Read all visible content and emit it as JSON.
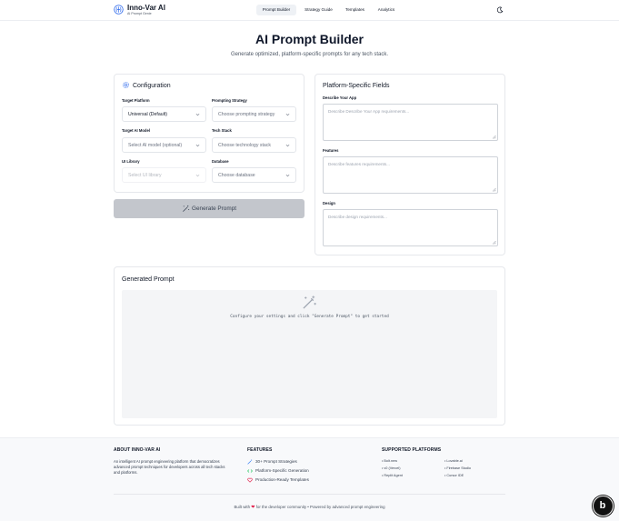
{
  "brand": {
    "title": "Inno-Var AI",
    "subtitle": "AI Prompt Genie"
  },
  "nav": {
    "items": [
      {
        "label": "Prompt Builder",
        "active": true
      },
      {
        "label": "Strategy Guide",
        "active": false
      },
      {
        "label": "Templates",
        "active": false
      },
      {
        "label": "Analytics",
        "active": false
      }
    ],
    "theme_icon": "moon-icon"
  },
  "hero": {
    "title": "AI Prompt Builder",
    "subtitle": "Generate optimized, platform-specific prompts for any tech stack."
  },
  "configuration": {
    "title": "Configuration",
    "icon": "settings-icon",
    "fields": {
      "target_platform": {
        "label": "Target Platform",
        "value": "Universal (Default)"
      },
      "prompting_strategy": {
        "label": "Prompting Strategy",
        "placeholder": "Choose prompting strategy"
      },
      "target_ai_model": {
        "label": "Target AI Model",
        "placeholder": "Select AI model (optional)"
      },
      "tech_stack": {
        "label": "Tech Stack",
        "placeholder": "Choose technology stack"
      },
      "ui_library": {
        "label": "UI Library",
        "placeholder": "Select UI library"
      },
      "database": {
        "label": "Database",
        "placeholder": "Choose database"
      }
    },
    "generate_button": {
      "label": "Generate Prompt",
      "icon": "magic-wand-icon"
    }
  },
  "platform_fields": {
    "title": "Platform-Specific Fields",
    "describe_app": {
      "label": "Describe Your App",
      "placeholder": "Describe Describe Your App requirements..."
    },
    "features": {
      "label": "Features",
      "placeholder": "Describe features requirements..."
    },
    "design": {
      "label": "Design",
      "placeholder": "Describe design requirements..."
    }
  },
  "generated": {
    "title": "Generated Prompt",
    "empty_message": "Configure your settings and click \"Generate Prompt\" to get started",
    "icon": "magic-wand-icon"
  },
  "footer": {
    "about": {
      "heading": "ABOUT INNO-VAR AI",
      "text": "An intelligent AI prompt engineering platform that democratizes advanced prompt techniques for developers across all tech stacks and platforms."
    },
    "features": {
      "heading": "FEATURES",
      "items": [
        {
          "label": "30+ Prompt Strategies",
          "icon": "wand-icon",
          "color": "#3b82f6"
        },
        {
          "label": "Platform-Specific Generation",
          "icon": "code-icon",
          "color": "#22c55e"
        },
        {
          "label": "Production-Ready Templates",
          "icon": "heart-icon",
          "color": "#e11d48"
        }
      ]
    },
    "platforms": {
      "heading": "SUPPORTED PLATFORMS",
      "items": [
        "• Bolt.new",
        "• Lovable.ai",
        "• v0 (Vercel)",
        "• Firebase Studio",
        "• Replit Agent",
        "• Cursor IDE"
      ]
    },
    "bottom": {
      "before": "Built with",
      "after": "for the developer community • Powered by advanced prompt engineering"
    }
  },
  "fab": {
    "letter": "b"
  }
}
